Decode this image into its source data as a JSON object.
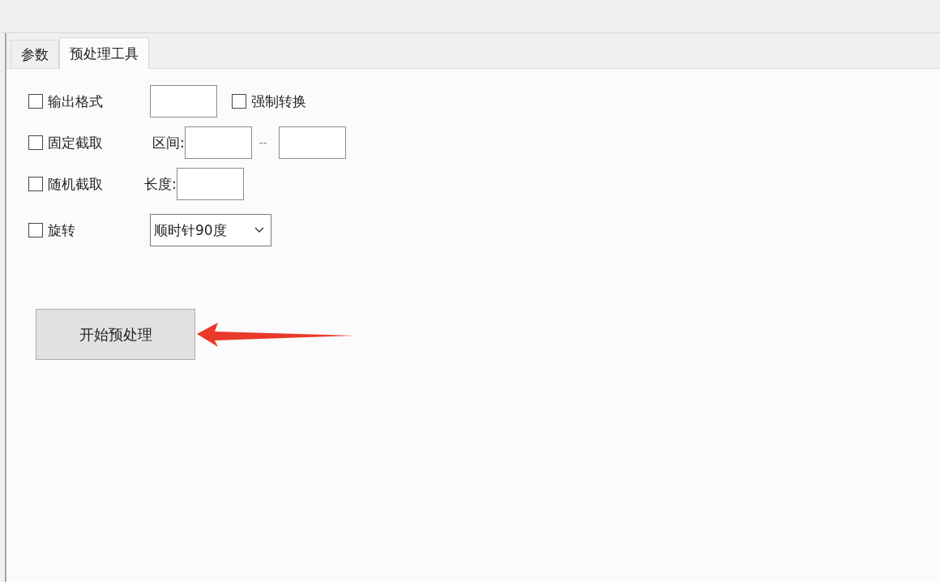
{
  "tabs": [
    {
      "label": "参数",
      "selected": false
    },
    {
      "label": "预处理工具",
      "selected": true
    }
  ],
  "options": [
    {
      "kind": "format",
      "label": "输出格式",
      "checked": false,
      "extra_checkbox": {
        "label": "强制转换",
        "checked": false
      }
    },
    {
      "kind": "range",
      "label": "固定截取",
      "checked": false,
      "field_label": "区间:",
      "separator": "--"
    },
    {
      "kind": "length",
      "label": "随机截取",
      "checked": false,
      "field_label": "长度:"
    },
    {
      "kind": "select",
      "label": "旋转",
      "checked": false,
      "value": "顺时针90度"
    }
  ],
  "start_button": "开始预处理"
}
